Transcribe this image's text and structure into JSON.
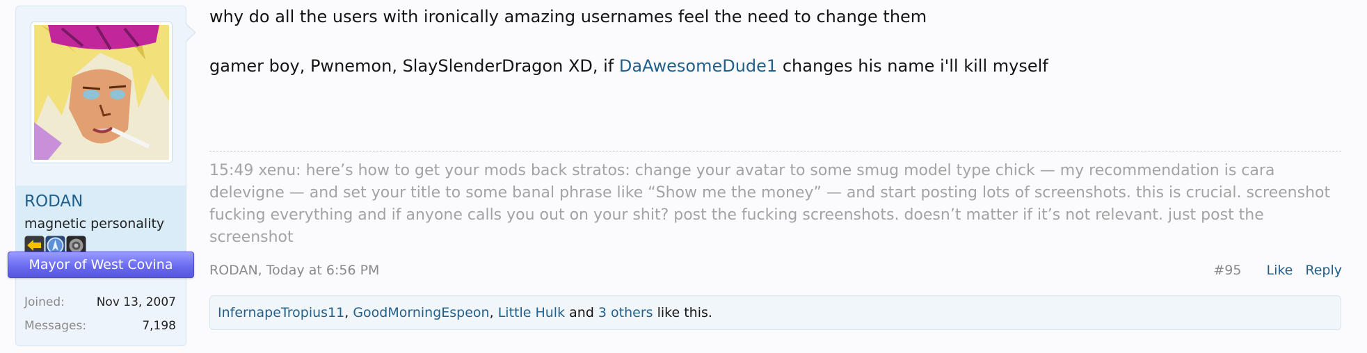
{
  "user": {
    "username": "RODAN",
    "title": "magnetic personality",
    "badges": [
      {
        "icon": "arrow-badge-icon",
        "color": "#f2c200"
      },
      {
        "icon": "blue-emblem-badge-icon",
        "color": "#5b8fd6"
      },
      {
        "icon": "grey-gear-badge-icon",
        "color": "#7b7b7b"
      }
    ],
    "banner": "Mayor of West Covina",
    "banner_color": "#6b6cf0",
    "stats": [
      {
        "label": "Joined:",
        "value": "Nov 13, 2007"
      },
      {
        "label": "Messages:",
        "value": "7,198"
      }
    ]
  },
  "message": {
    "line1": "why do all the users with ironically amazing usernames feel the need to change them",
    "line2_before": "gamer boy, Pwnemon, SlaySlenderDragon XD, if ",
    "line2_mention": "DaAwesomeDude1",
    "line2_after": " changes his name i'll kill myself"
  },
  "signature": "15:49 xenu: here’s how to get your mods back stratos: change your avatar to some smug model type chick — my recommendation is cara delevigne — and set your title to some banal phrase like “Show me the money” — and start posting lots of screenshots. this is crucial. screenshot fucking everything and if anyone calls you out on your shit? post the fucking screenshots. doesn’t matter if it’s not relevant. just post the screenshot",
  "meta": {
    "author_time": "RODAN, Today at 6:56 PM",
    "post_number": "#95",
    "like_label": "Like",
    "reply_label": "Reply"
  },
  "likes": {
    "user1": "InfernapeTropius11",
    "sep1": ", ",
    "user2": "GoodMorningEspeon",
    "sep2": ", ",
    "user3": "Little Hulk",
    "and_text": " and ",
    "others": "3 others",
    "suffix": " like this."
  },
  "colors": {
    "link": "#22608c",
    "signature_text": "#a3a3a3",
    "sidebar_bg": "#eef4fb"
  }
}
